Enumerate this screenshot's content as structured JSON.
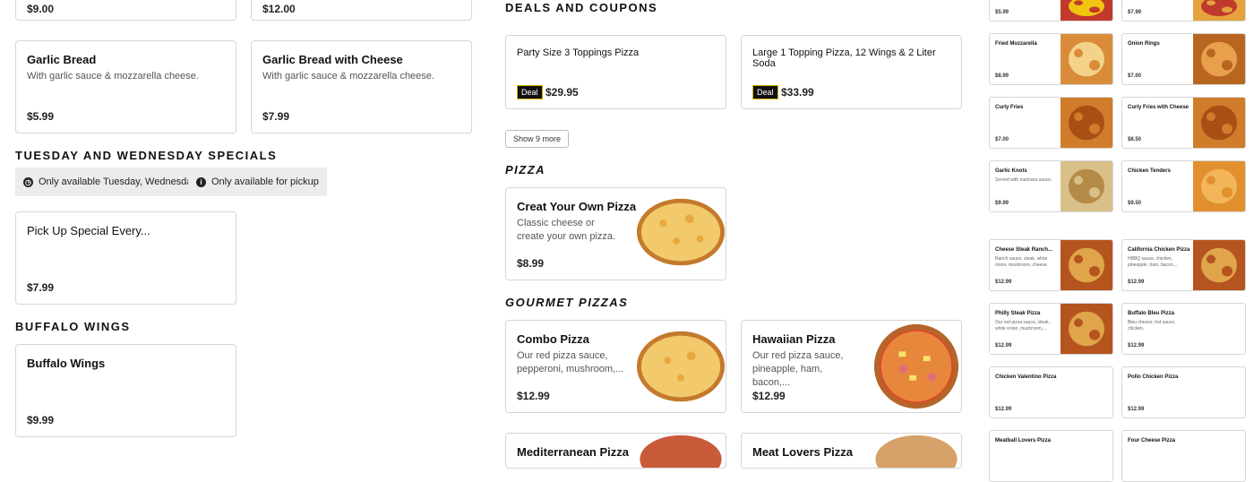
{
  "top_cards": [
    {
      "price": "$9.00"
    },
    {
      "price": "$12.00"
    }
  ],
  "garlic": [
    {
      "title": "Garlic Bread",
      "desc": "With garlic sauce & mozzarella cheese.",
      "price": "$5.99"
    },
    {
      "title": "Garlic Bread with Cheese",
      "desc": "With garlic sauce & mozzarella cheese.",
      "price": "$7.99"
    }
  ],
  "tuesday": {
    "heading": "Tuesday and Wednesday Specials",
    "chips": [
      "Only available Tuesday, Wednesday",
      "Only available for pickup"
    ],
    "item": {
      "title": "Pick Up Special Every...",
      "price": "$7.99"
    }
  },
  "wings": {
    "heading": "Buffalo Wings",
    "item": {
      "title": "Buffalo Wings",
      "price": "$9.99"
    }
  },
  "deals": {
    "heading": "Deals and Coupons",
    "items": [
      {
        "title": "Party Size 3 Toppings Pizza",
        "badge": "Deal",
        "price": "$29.95"
      },
      {
        "title": "Large 1 Topping Pizza, 12 Wings & 2 Liter Soda",
        "badge": "Deal",
        "price": "$33.99"
      }
    ],
    "show_more": "Show 9 more"
  },
  "pizza": {
    "heading": "Pizza",
    "item": {
      "title": "Creat Your Own Pizza",
      "desc": "Classic cheese or create your own pizza.",
      "price": "$8.99"
    }
  },
  "gourmet": {
    "heading": "Gourmet Pizzas",
    "items": [
      {
        "title": "Combo Pizza",
        "desc": "Our red pizza sauce, pepperoni, mushroom,...",
        "price": "$12.99"
      },
      {
        "title": "Hawaiian Pizza",
        "desc": "Our red pizza sauce, pineapple, ham, bacon,...",
        "price": "$12.99"
      }
    ],
    "next_row": [
      "Mediterranean Pizza",
      "Meat Lovers Pizza"
    ]
  },
  "sidebar": [
    {
      "title": "",
      "desc": "",
      "price": "$5.99",
      "img": "ketchup"
    },
    {
      "title": "",
      "desc": "",
      "price": "$7.99",
      "img": "fries"
    },
    {
      "title": "Fried Mozzarella",
      "desc": "",
      "price": "$8.99",
      "img": "mozz"
    },
    {
      "title": "Onion Rings",
      "desc": "",
      "price": "$7.00",
      "img": "rings"
    },
    {
      "title": "Curly Fries",
      "desc": "",
      "price": "$7.00",
      "img": "curly"
    },
    {
      "title": "Curly Fries with Cheese",
      "desc": "",
      "price": "$8.50",
      "img": "curly"
    },
    {
      "title": "Garlic Knots",
      "desc": "Served with marinara sauce.",
      "price": "$9.99",
      "img": "knots"
    },
    {
      "title": "Chicken Tenders",
      "desc": "",
      "price": "$9.50",
      "img": "tenders"
    },
    {
      "title": "Cheese Steak Ranch...",
      "desc": "Ranch sauce, steak, white onion, mushroom, cheese.",
      "price": "$12.99",
      "img": "pizza"
    },
    {
      "title": "California Chicken Pizza",
      "desc": "HBBQ sauce, chicken, pineapple ,ham, bacon,...",
      "price": "$12.99",
      "img": "pizza"
    },
    {
      "title": "Philly Steak Pizza",
      "desc": "Our red pizza sauce, steak, white onion ,mushroom,...",
      "price": "$12.99",
      "img": "pizza"
    },
    {
      "title": "Buffalo Bleu Pizza",
      "desc": "Bleu cheese, hot sauce, chicken.",
      "price": "$12.99",
      "img": ""
    },
    {
      "title": "Chicken Valentino Pizza",
      "desc": "",
      "price": "$12.99",
      "img": ""
    },
    {
      "title": "Pollo Chicken Pizza",
      "desc": "",
      "price": "$12.99",
      "img": ""
    },
    {
      "title": "Meatball Lovers Pizza",
      "desc": "",
      "price": "",
      "img": ""
    },
    {
      "title": "Four Cheese Pizza",
      "desc": "",
      "price": "",
      "img": ""
    }
  ]
}
